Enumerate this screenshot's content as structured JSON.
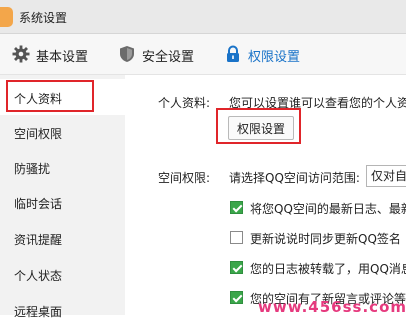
{
  "window": {
    "title": "系统设置"
  },
  "tabs": [
    {
      "label": "基本设置",
      "icon": "gear-icon"
    },
    {
      "label": "安全设置",
      "icon": "shield-icon"
    },
    {
      "label": "权限设置",
      "icon": "lock-icon"
    }
  ],
  "sidebar": {
    "items": [
      {
        "label": "个人资料"
      },
      {
        "label": "空间权限"
      },
      {
        "label": "防骚扰"
      },
      {
        "label": "临时会话"
      },
      {
        "label": "资讯提醒"
      },
      {
        "label": "个人状态"
      },
      {
        "label": "远程桌面"
      }
    ]
  },
  "content": {
    "profile_label": "个人资料:",
    "profile_desc": "您可以设置谁可以查看您的个人资",
    "perm_button": "权限设置",
    "space_label": "空间权限:",
    "space_desc": "请选择QQ空间访问范围:",
    "space_select": "仅对自",
    "options": [
      {
        "label": "将您QQ空间的最新日志、最新",
        "checked": true
      },
      {
        "label": "更新说说时同步更新QQ签名",
        "checked": false
      },
      {
        "label": "您的日志被转载了，用QQ消息",
        "checked": true
      },
      {
        "label": "您的空间有了新留言或评论等",
        "checked": true
      }
    ]
  },
  "watermark": "www.456ss.com",
  "colors": {
    "accent": "#1a73c8",
    "highlight": "#e0252a",
    "checkbox": "#3aa64a",
    "watermark": "#e63a7e"
  }
}
